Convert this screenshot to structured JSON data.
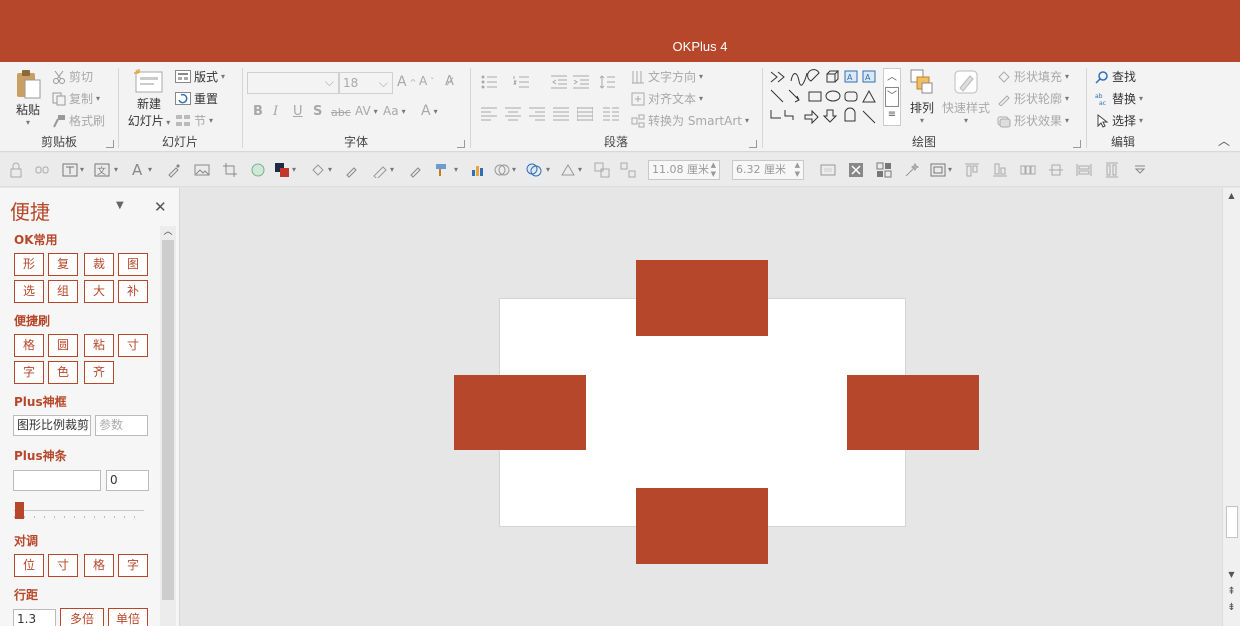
{
  "colors": {
    "accent": "#b7472a"
  },
  "window": {
    "title": "OKPlus 4"
  },
  "ribbon": {
    "clipboard": {
      "label": "剪贴板",
      "paste": "粘贴",
      "cut": "剪切",
      "copy": "复制",
      "format_painter": "格式刷"
    },
    "slides": {
      "label": "幻灯片",
      "new_slide_line1": "新建",
      "new_slide_line2": "幻灯片",
      "layout": "版式",
      "reset": "重置",
      "section": "节"
    },
    "font": {
      "label": "字体",
      "font_name": "",
      "font_size": "18"
    },
    "paragraph": {
      "label": "段落",
      "text_direction": "文字方向",
      "align_text": "对齐文本",
      "convert_smartart": "转换为 SmartArt"
    },
    "drawing": {
      "label": "绘图",
      "arrange": "排列",
      "quick_styles": "快速样式",
      "shape_fill": "形状填充",
      "shape_outline": "形状轮廓",
      "shape_effects": "形状效果"
    },
    "editing": {
      "label": "编辑",
      "find": "查找",
      "replace": "替换",
      "select": "选择"
    }
  },
  "quickbar": {
    "width": "11.08 厘米",
    "height": "6.32 厘米"
  },
  "panel": {
    "title": "便捷",
    "ok_common": {
      "label": "OK常用",
      "buttons": [
        "形",
        "复",
        "裁",
        "图",
        "选",
        "组",
        "大",
        "补"
      ]
    },
    "brush": {
      "label": "便捷刷",
      "buttons": [
        "格",
        "圆",
        "粘",
        "寸",
        "字",
        "色",
        "齐"
      ]
    },
    "plus_frame": {
      "label": "Plus神框",
      "input": "图形比例裁剪",
      "param_placeholder": "参数"
    },
    "plus_bar": {
      "label": "Plus神条",
      "value": "0"
    },
    "align": {
      "label": "对调",
      "buttons": [
        "位",
        "寸",
        "格",
        "字"
      ]
    },
    "line_spacing": {
      "label": "行距",
      "value": "1.3",
      "multi": "多倍",
      "single": "单倍"
    }
  }
}
